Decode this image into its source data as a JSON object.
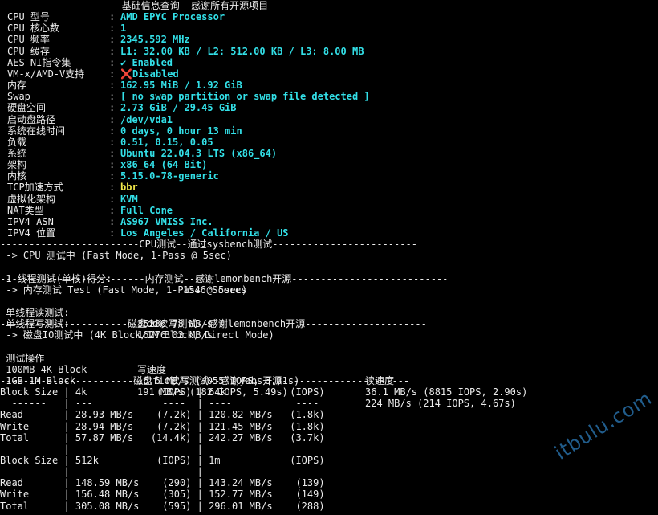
{
  "sections": {
    "basic": "---------------------基础信息查询--感谢所有开源项目---------------------",
    "cpu": "------------------------CPU测试--通过sysbench测试-------------------------",
    "mem": "-------------------------内存测试--感谢lemonbench开源---------------------------",
    "dd": "----------------------磁盘dd读写测试--感谢lemonbench开源---------------------",
    "fio": "-----------------------磁盘fio读写测试--感谢yabs开源----------------------"
  },
  "basic_info": [
    {
      "label": "CPU 型号",
      "value": "AMD EPYC Processor",
      "color": "#33e0e8"
    },
    {
      "label": "CPU 核心数",
      "value": "1",
      "color": "#33e0e8"
    },
    {
      "label": "CPU 频率",
      "value": "2345.592 MHz",
      "color": "#33e0e8"
    },
    {
      "label": "CPU 缓存",
      "value": "L1: 32.00 KB / L2: 512.00 KB / L3: 8.00 MB",
      "color": "#33e0e8"
    },
    {
      "label": "AES-NI指令集",
      "value": "✔ Enabled",
      "color": "#33e0e8"
    },
    {
      "label": "VM-x/AMD-V支持",
      "value": "❌Disabled",
      "color": "#33e0e8"
    },
    {
      "label": "内存",
      "value": "162.95 MiB / 1.92 GiB",
      "color": "#33e0e8"
    },
    {
      "label": "Swap",
      "value": "[ no swap partition or swap file detected ]",
      "color": "#33e0e8"
    },
    {
      "label": "硬盘空间",
      "value": "2.73 GiB / 29.45 GiB",
      "color": "#33e0e8"
    },
    {
      "label": "启动盘路径",
      "value": "/dev/vda1",
      "color": "#33e0e8"
    },
    {
      "label": "系统在线时间",
      "value": "0 days, 0 hour 13 min",
      "color": "#33e0e8"
    },
    {
      "label": "负载",
      "value": "0.51, 0.15, 0.05",
      "color": "#33e0e8"
    },
    {
      "label": "系统",
      "value": "Ubuntu 22.04.3 LTS (x86_64)",
      "color": "#33e0e8"
    },
    {
      "label": "架构",
      "value": "x86_64 (64 Bit)",
      "color": "#33e0e8"
    },
    {
      "label": "内核",
      "value": "5.15.0-78-generic",
      "color": "#33e0e8"
    },
    {
      "label": "TCP加速方式",
      "value": "bbr",
      "color": "#f2e84a"
    },
    {
      "label": "虚拟化架构",
      "value": "KVM",
      "color": "#33e0e8"
    },
    {
      "label": "NAT类型",
      "value": "Full Cone",
      "color": "#33e0e8"
    },
    {
      "label": "IPV4 ASN",
      "value": "AS967 VMISS Inc.",
      "color": "#33e0e8"
    },
    {
      "label": "IPV4 位置",
      "value": "Los Angeles / California / US",
      "color": "#33e0e8"
    }
  ],
  "separator": ":",
  "cpu_test": {
    "mode": " -> CPU 测试中 (Fast Mode, 1-Pass @ 5sec)",
    "label": " 1 线程测试(单核)得分:",
    "score": "1546 Scores"
  },
  "mem_test": {
    "mode": " -> 内存测试 Test (Fast Mode, 1-Pass @ 5sec)",
    "rows": [
      {
        "label": " 单线程读测试:",
        "value": "35286.78 MB/s"
      },
      {
        "label": " 单线程写测试:",
        "value": "16276.02 MB/s"
      }
    ]
  },
  "dd_test": {
    "mode": " -> 磁盘IO测试中 (4K Block/1M Block, Direct Mode)",
    "headers": [
      " 测试操作",
      "写速度",
      "读速度"
    ],
    "rows": [
      {
        "op": " 100MB-4K Block",
        "write": "16.6 MB/s (4055 IOPS, 6.31s)",
        "read": "36.1 MB/s (8815 IOPS, 2.90s)"
      },
      {
        "op": " 1GB-1M Block",
        "write": "191 MB/s (182 IOPS, 5.49s)",
        "read": "224 MB/s (214 IOPS, 4.67s)"
      }
    ]
  },
  "fio_lines": [
    "Block Size | 4k            (IOPS) | 64k           (IOPS)",
    "  ------   | ---            ----  | ----           ---- ",
    "Read       | 28.93 MB/s    (7.2k) | 120.82 MB/s   (1.8k)",
    "Write      | 28.94 MB/s    (7.2k) | 121.45 MB/s   (1.8k)",
    "Total      | 57.87 MB/s   (14.4k) | 242.27 MB/s   (3.7k)",
    "           |                      |                     ",
    "Block Size | 512k          (IOPS) | 1m            (IOPS)",
    "  ------   | ---            ----  | ----           ---- ",
    "Read       | 148.59 MB/s    (290) | 143.24 MB/s    (139)",
    "Write      | 156.48 MB/s    (305) | 152.77 MB/s    (149)",
    "Total      | 305.08 MB/s    (595) | 296.01 MB/s    (288)"
  ],
  "watermark": "itbulu.com"
}
